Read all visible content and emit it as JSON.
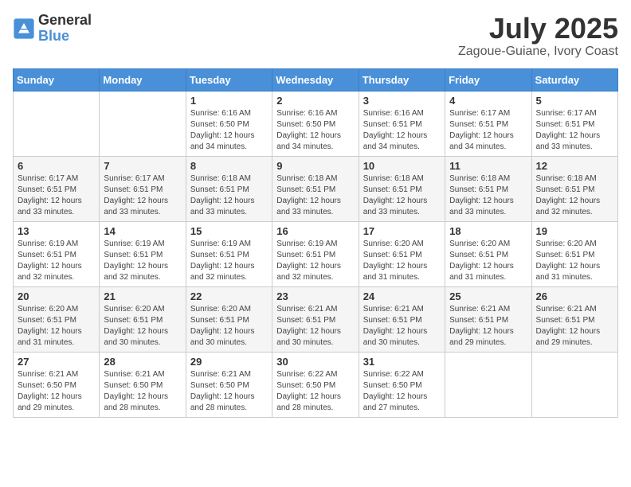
{
  "logo": {
    "general": "General",
    "blue": "Blue"
  },
  "title": "July 2025",
  "location": "Zagoue-Guiane, Ivory Coast",
  "days_of_week": [
    "Sunday",
    "Monday",
    "Tuesday",
    "Wednesday",
    "Thursday",
    "Friday",
    "Saturday"
  ],
  "weeks": [
    [
      {
        "day": "",
        "info": ""
      },
      {
        "day": "",
        "info": ""
      },
      {
        "day": "1",
        "info": "Sunrise: 6:16 AM\nSunset: 6:50 PM\nDaylight: 12 hours and 34 minutes."
      },
      {
        "day": "2",
        "info": "Sunrise: 6:16 AM\nSunset: 6:50 PM\nDaylight: 12 hours and 34 minutes."
      },
      {
        "day": "3",
        "info": "Sunrise: 6:16 AM\nSunset: 6:51 PM\nDaylight: 12 hours and 34 minutes."
      },
      {
        "day": "4",
        "info": "Sunrise: 6:17 AM\nSunset: 6:51 PM\nDaylight: 12 hours and 34 minutes."
      },
      {
        "day": "5",
        "info": "Sunrise: 6:17 AM\nSunset: 6:51 PM\nDaylight: 12 hours and 33 minutes."
      }
    ],
    [
      {
        "day": "6",
        "info": "Sunrise: 6:17 AM\nSunset: 6:51 PM\nDaylight: 12 hours and 33 minutes."
      },
      {
        "day": "7",
        "info": "Sunrise: 6:17 AM\nSunset: 6:51 PM\nDaylight: 12 hours and 33 minutes."
      },
      {
        "day": "8",
        "info": "Sunrise: 6:18 AM\nSunset: 6:51 PM\nDaylight: 12 hours and 33 minutes."
      },
      {
        "day": "9",
        "info": "Sunrise: 6:18 AM\nSunset: 6:51 PM\nDaylight: 12 hours and 33 minutes."
      },
      {
        "day": "10",
        "info": "Sunrise: 6:18 AM\nSunset: 6:51 PM\nDaylight: 12 hours and 33 minutes."
      },
      {
        "day": "11",
        "info": "Sunrise: 6:18 AM\nSunset: 6:51 PM\nDaylight: 12 hours and 33 minutes."
      },
      {
        "day": "12",
        "info": "Sunrise: 6:18 AM\nSunset: 6:51 PM\nDaylight: 12 hours and 32 minutes."
      }
    ],
    [
      {
        "day": "13",
        "info": "Sunrise: 6:19 AM\nSunset: 6:51 PM\nDaylight: 12 hours and 32 minutes."
      },
      {
        "day": "14",
        "info": "Sunrise: 6:19 AM\nSunset: 6:51 PM\nDaylight: 12 hours and 32 minutes."
      },
      {
        "day": "15",
        "info": "Sunrise: 6:19 AM\nSunset: 6:51 PM\nDaylight: 12 hours and 32 minutes."
      },
      {
        "day": "16",
        "info": "Sunrise: 6:19 AM\nSunset: 6:51 PM\nDaylight: 12 hours and 32 minutes."
      },
      {
        "day": "17",
        "info": "Sunrise: 6:20 AM\nSunset: 6:51 PM\nDaylight: 12 hours and 31 minutes."
      },
      {
        "day": "18",
        "info": "Sunrise: 6:20 AM\nSunset: 6:51 PM\nDaylight: 12 hours and 31 minutes."
      },
      {
        "day": "19",
        "info": "Sunrise: 6:20 AM\nSunset: 6:51 PM\nDaylight: 12 hours and 31 minutes."
      }
    ],
    [
      {
        "day": "20",
        "info": "Sunrise: 6:20 AM\nSunset: 6:51 PM\nDaylight: 12 hours and 31 minutes."
      },
      {
        "day": "21",
        "info": "Sunrise: 6:20 AM\nSunset: 6:51 PM\nDaylight: 12 hours and 30 minutes."
      },
      {
        "day": "22",
        "info": "Sunrise: 6:20 AM\nSunset: 6:51 PM\nDaylight: 12 hours and 30 minutes."
      },
      {
        "day": "23",
        "info": "Sunrise: 6:21 AM\nSunset: 6:51 PM\nDaylight: 12 hours and 30 minutes."
      },
      {
        "day": "24",
        "info": "Sunrise: 6:21 AM\nSunset: 6:51 PM\nDaylight: 12 hours and 30 minutes."
      },
      {
        "day": "25",
        "info": "Sunrise: 6:21 AM\nSunset: 6:51 PM\nDaylight: 12 hours and 29 minutes."
      },
      {
        "day": "26",
        "info": "Sunrise: 6:21 AM\nSunset: 6:51 PM\nDaylight: 12 hours and 29 minutes."
      }
    ],
    [
      {
        "day": "27",
        "info": "Sunrise: 6:21 AM\nSunset: 6:50 PM\nDaylight: 12 hours and 29 minutes."
      },
      {
        "day": "28",
        "info": "Sunrise: 6:21 AM\nSunset: 6:50 PM\nDaylight: 12 hours and 28 minutes."
      },
      {
        "day": "29",
        "info": "Sunrise: 6:21 AM\nSunset: 6:50 PM\nDaylight: 12 hours and 28 minutes."
      },
      {
        "day": "30",
        "info": "Sunrise: 6:22 AM\nSunset: 6:50 PM\nDaylight: 12 hours and 28 minutes."
      },
      {
        "day": "31",
        "info": "Sunrise: 6:22 AM\nSunset: 6:50 PM\nDaylight: 12 hours and 27 minutes."
      },
      {
        "day": "",
        "info": ""
      },
      {
        "day": "",
        "info": ""
      }
    ]
  ]
}
